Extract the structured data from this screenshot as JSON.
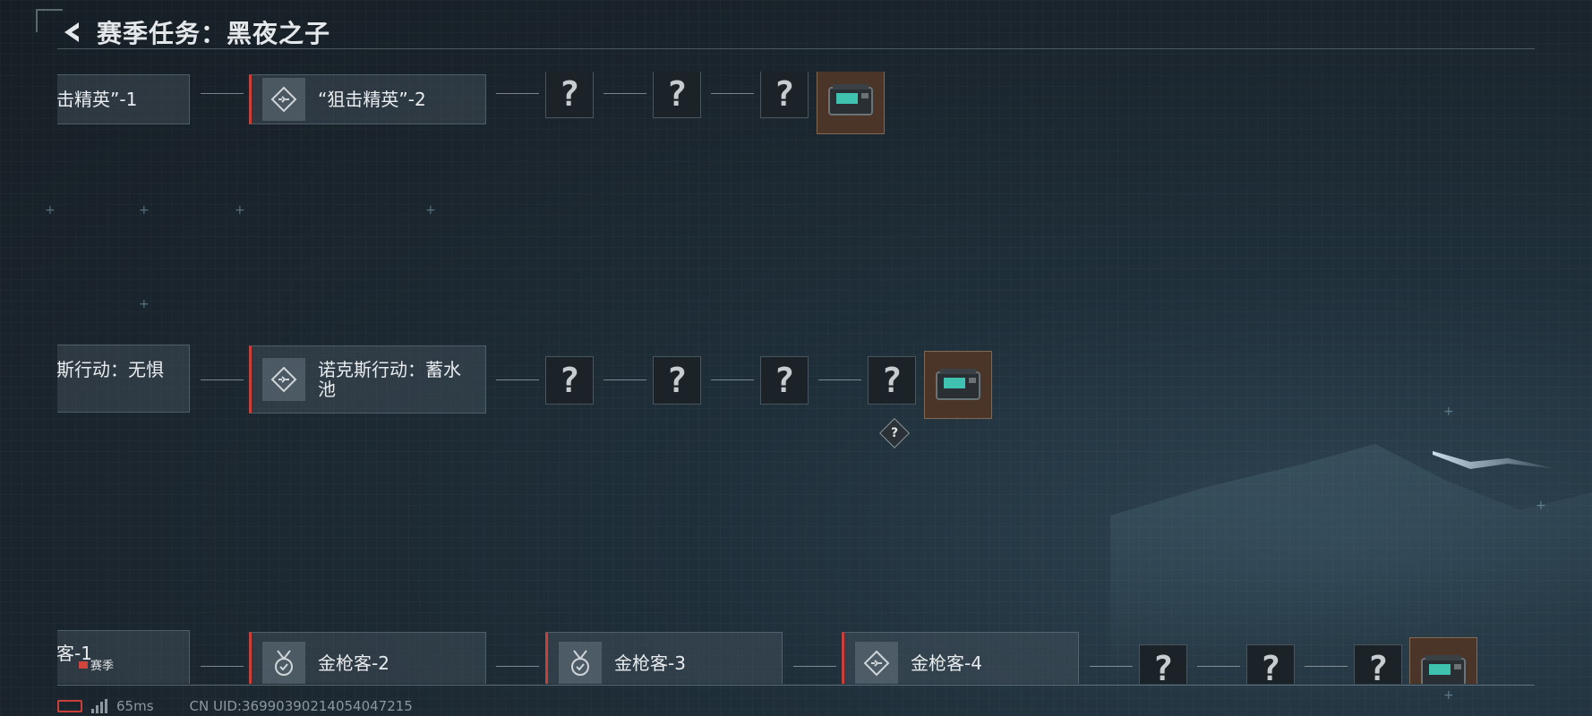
{
  "header": {
    "title": "赛季任务：黑夜之子"
  },
  "rows": [
    {
      "cards": [
        {
          "label": "击精英”-1",
          "icon": "diamond-arrows-icon"
        },
        {
          "label": "“狙击精英”-2",
          "icon": "diamond-arrows-icon"
        }
      ],
      "unknown_nodes": [
        "?",
        "?",
        "?"
      ],
      "reward": "supply-crate-icon"
    },
    {
      "cards": [
        {
          "label": "斯行动：无惧",
          "icon": "diamond-arrows-icon"
        },
        {
          "label": "诺克斯行动：蓄水池",
          "icon": "diamond-arrows-icon"
        }
      ],
      "unknown_nodes": [
        "?",
        "?",
        "?",
        "?"
      ],
      "hidden_branch": "?",
      "reward": "supply-crate-icon"
    },
    {
      "cards": [
        {
          "label": "客-1",
          "icon": "medal-icon"
        },
        {
          "label": "金枪客-2",
          "icon": "medal-icon"
        },
        {
          "label": "金枪客-3",
          "icon": "medal-icon"
        },
        {
          "label": "金枪客-4",
          "icon": "diamond-arrows-icon"
        }
      ],
      "unknown_nodes": [
        "?",
        "?",
        "?"
      ],
      "reward": "supply-crate-icon"
    }
  ],
  "season_badge": "赛季",
  "status": {
    "ping": "65ms",
    "uid": "CN UID:36990390214054047215"
  },
  "colors": {
    "accent_red": "#c9403a",
    "reward_bg": "#4a3528",
    "background": "#1a242c"
  }
}
